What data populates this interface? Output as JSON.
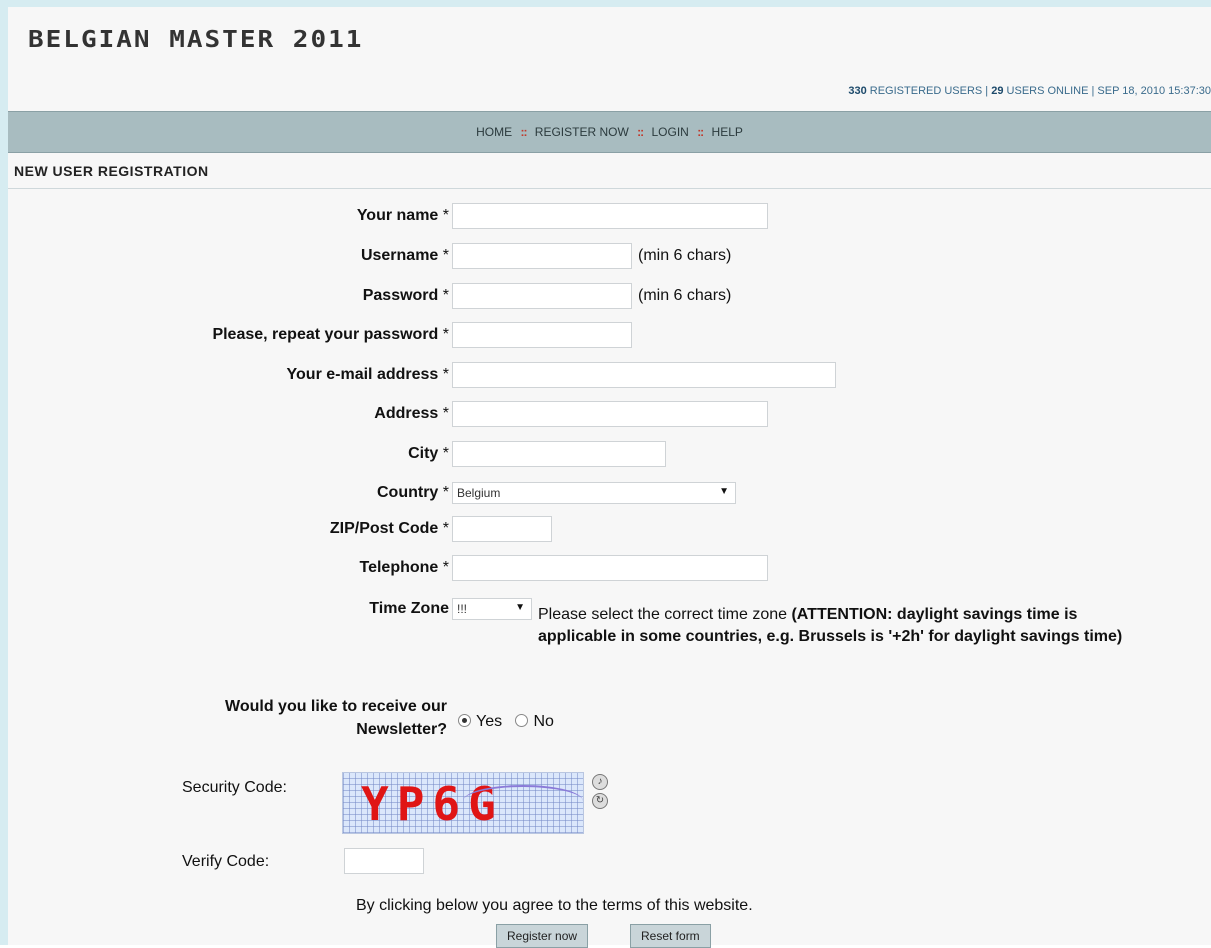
{
  "site": {
    "logo": "BELGIAN MASTER 2011"
  },
  "status": {
    "registered_count": "330",
    "registered_label": "REGISTERED USERS |",
    "online_count": "29",
    "online_label": "USERS ONLINE | SEP 18, 2010 15:37:30"
  },
  "nav": {
    "items": [
      {
        "label": "HOME"
      },
      {
        "label": "REGISTER NOW"
      },
      {
        "label": "LOGIN"
      },
      {
        "label": "HELP"
      }
    ],
    "separator": "::"
  },
  "form": {
    "title": "NEW USER REGISTRATION",
    "required_mark": "*",
    "name_label": "Your name",
    "username_label": "Username",
    "username_hint": "(min 6 chars)",
    "password_label": "Password",
    "password_hint": "(min 6 chars)",
    "repeat_password_label": "Please, repeat your password",
    "email_label": "Your e-mail address",
    "address_label": "Address",
    "city_label": "City",
    "country_label": "Country",
    "country_value": "Belgium",
    "zip_label": "ZIP/Post Code",
    "telephone_label": "Telephone",
    "timezone_label": "Time Zone",
    "timezone_value": "!!!",
    "timezone_text": "Please select the correct time zone",
    "timezone_attention": "(ATTENTION: daylight savings time is applicable in some countries, e.g. Brussels is '+2h' for daylight savings time)",
    "newsletter_label_line1": "Would you like to receive our",
    "newsletter_label_line2": "Newsletter?",
    "newsletter_yes": "Yes",
    "newsletter_no": "No",
    "newsletter_selected": "Yes",
    "security_code_label": "Security Code:",
    "captcha_text": "YP6G",
    "verify_code_label": "Verify Code:",
    "terms_text": "By clicking below you agree to the terms of this website.",
    "register_button": "Register now",
    "reset_button": "Reset form"
  },
  "icons": {
    "audio": "speaker-icon",
    "refresh": "refresh-icon",
    "dropdown": "chevron-down-icon"
  }
}
